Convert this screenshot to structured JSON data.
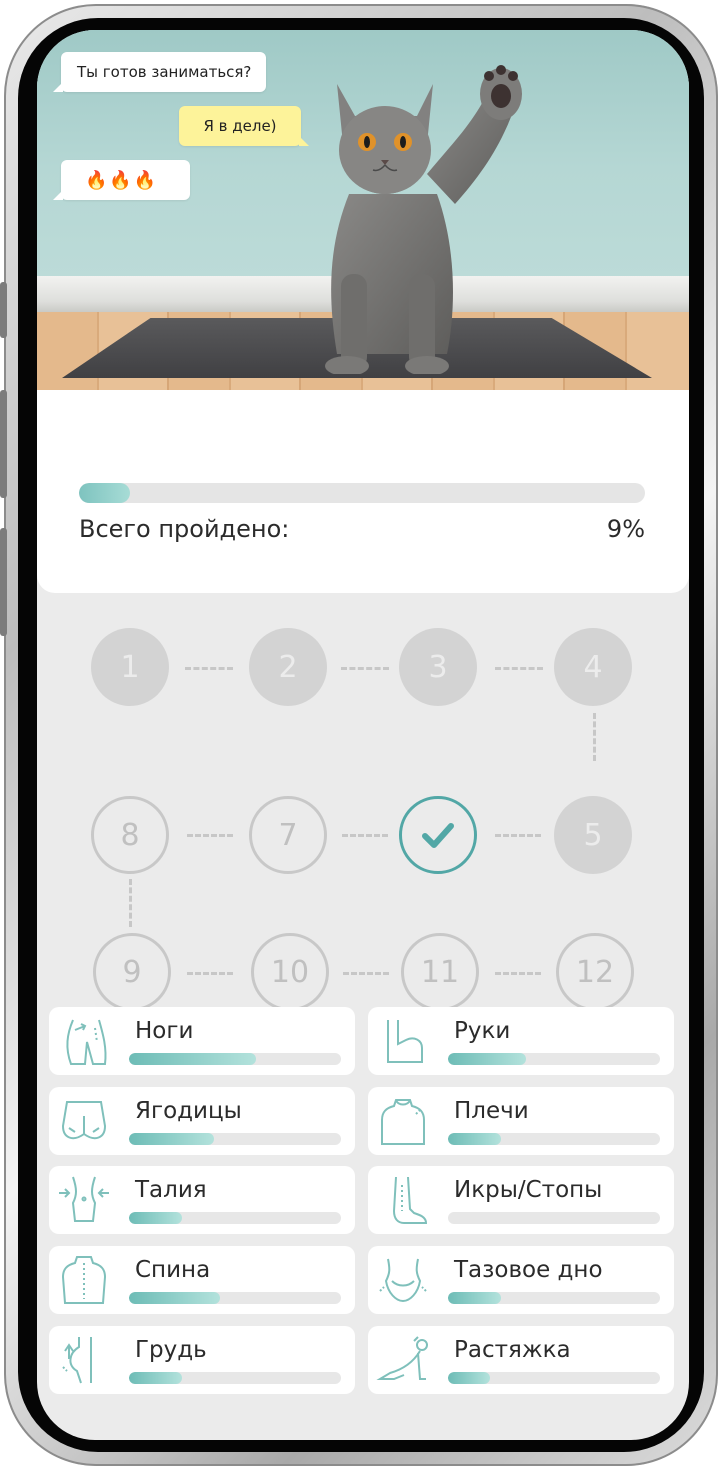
{
  "hero": {
    "bubble_question": "Ты готов заниматься?",
    "bubble_answer": "Я в деле)",
    "bubble_emojis": "🔥🔥🔥"
  },
  "progress": {
    "label": "Всего пройдено:",
    "value_text": "9%",
    "fraction": 0.09
  },
  "roadmap": {
    "nodes": [
      "1",
      "2",
      "3",
      "4",
      "5",
      "✓",
      "7",
      "8",
      "9",
      "10",
      "11",
      "12"
    ],
    "completed_index": 6
  },
  "categories": [
    {
      "label": "Ноги",
      "progress": 0.6,
      "icon": "legs-icon"
    },
    {
      "label": "Руки",
      "progress": 0.37,
      "icon": "arm-icon"
    },
    {
      "label": "Ягодицы",
      "progress": 0.4,
      "icon": "glutes-icon"
    },
    {
      "label": "Плечи",
      "progress": 0.25,
      "icon": "shoulders-icon"
    },
    {
      "label": "Талия",
      "progress": 0.25,
      "icon": "waist-icon"
    },
    {
      "label": "Икры/Стопы",
      "progress": 0.0,
      "icon": "calves-feet-icon"
    },
    {
      "label": "Спина",
      "progress": 0.43,
      "icon": "back-icon"
    },
    {
      "label": "Тазовое дно",
      "progress": 0.25,
      "icon": "pelvic-floor-icon"
    },
    {
      "label": "Грудь",
      "progress": 0.25,
      "icon": "chest-icon"
    },
    {
      "label": "Растяжка",
      "progress": 0.2,
      "icon": "stretching-icon"
    }
  ],
  "colors": {
    "accent": "#52a7a6",
    "progress_fill": "#7ec3bf",
    "node_inactive": "#d3d3d3",
    "bubble_yellow": "#fdf39a"
  }
}
